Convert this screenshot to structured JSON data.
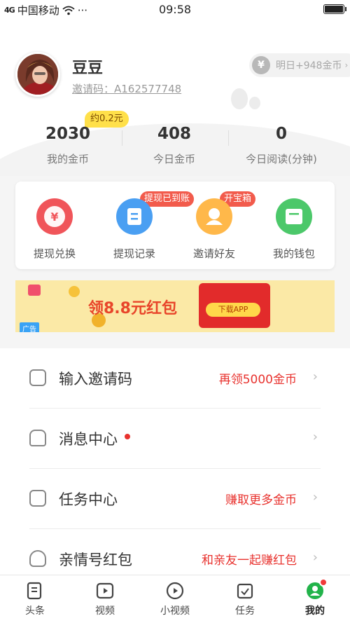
{
  "status_bar": {
    "signal": "4G",
    "carrier": "中国移动",
    "dots": "···",
    "time": "09:58"
  },
  "profile": {
    "name": "豆豆",
    "invite_code": "邀请码：A162577748",
    "coin_pill": "明日+948金币",
    "coin_pill_icon": "¥"
  },
  "stats": {
    "badge": "约0.2元",
    "items": [
      {
        "value": "2030",
        "label": "我的金币"
      },
      {
        "value": "408",
        "label": "今日金币"
      },
      {
        "value": "0",
        "label": "今日阅读(分钟)"
      }
    ]
  },
  "actions": [
    {
      "label": "提现兑换",
      "icon": "yen-circle-icon",
      "color": "#f0555a"
    },
    {
      "label": "提现记录",
      "icon": "record-icon",
      "color": "#4a9ff2",
      "tag": "提现已到账"
    },
    {
      "label": "邀请好友",
      "icon": "friend-icon",
      "color": "#ffb84a",
      "tag": "开宝箱"
    },
    {
      "label": "我的钱包",
      "icon": "wallet-icon",
      "color": "#4cc86a"
    }
  ],
  "ad": {
    "title": "领8.8元红包",
    "button": "下载APP",
    "tag": "广告"
  },
  "list": [
    {
      "label": "输入邀请码",
      "right": "再领5000金币"
    },
    {
      "label": "消息中心",
      "right": ""
    },
    {
      "label": "任务中心",
      "right": "赚取更多金币"
    },
    {
      "label": "亲情号红包",
      "right": "和亲友一起赚红包"
    }
  ],
  "tabs": [
    {
      "label": "头条"
    },
    {
      "label": "视频"
    },
    {
      "label": "小视频"
    },
    {
      "label": "任务"
    },
    {
      "label": "我的"
    }
  ]
}
